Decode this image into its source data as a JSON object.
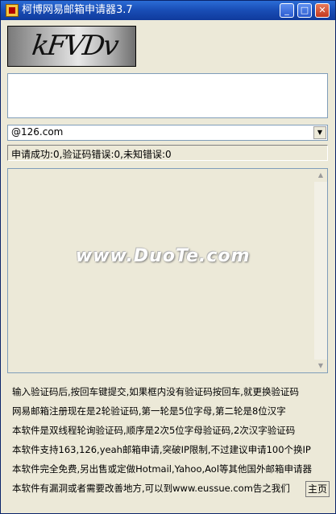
{
  "window": {
    "title": "柯博网易邮箱申请器3.7",
    "min_glyph": "_",
    "max_glyph": "□",
    "close_glyph": "✕"
  },
  "captcha": {
    "text": "kFVDv"
  },
  "email_domain": {
    "selected": "@126.com"
  },
  "status": {
    "text": "申请成功:0,验证码错误:0,未知错误:0"
  },
  "log": {
    "watermark": "www.DuoTe.com"
  },
  "info": {
    "lines": [
      "输入验证码后,按回车键提交,如果框内没有验证码按回车,就更换验证码",
      "网易邮箱注册现在是2轮验证码,第一轮是5位字母,第二轮是8位汉字",
      "本软件是双线程轮询验证码,顺序是2次5位字母验证码,2次汉字验证码",
      "本软件支持163,126,yeah邮箱申请,突破IP限制,不过建议申请100个换IP",
      "本软件完全免费,另出售或定做Hotmail,Yahoo,Aol等其他国外邮箱申请器",
      "本软件有漏洞或者需要改善地方,可以到www.eussue.com告之我们"
    ]
  },
  "home_button": {
    "label": "主页"
  }
}
